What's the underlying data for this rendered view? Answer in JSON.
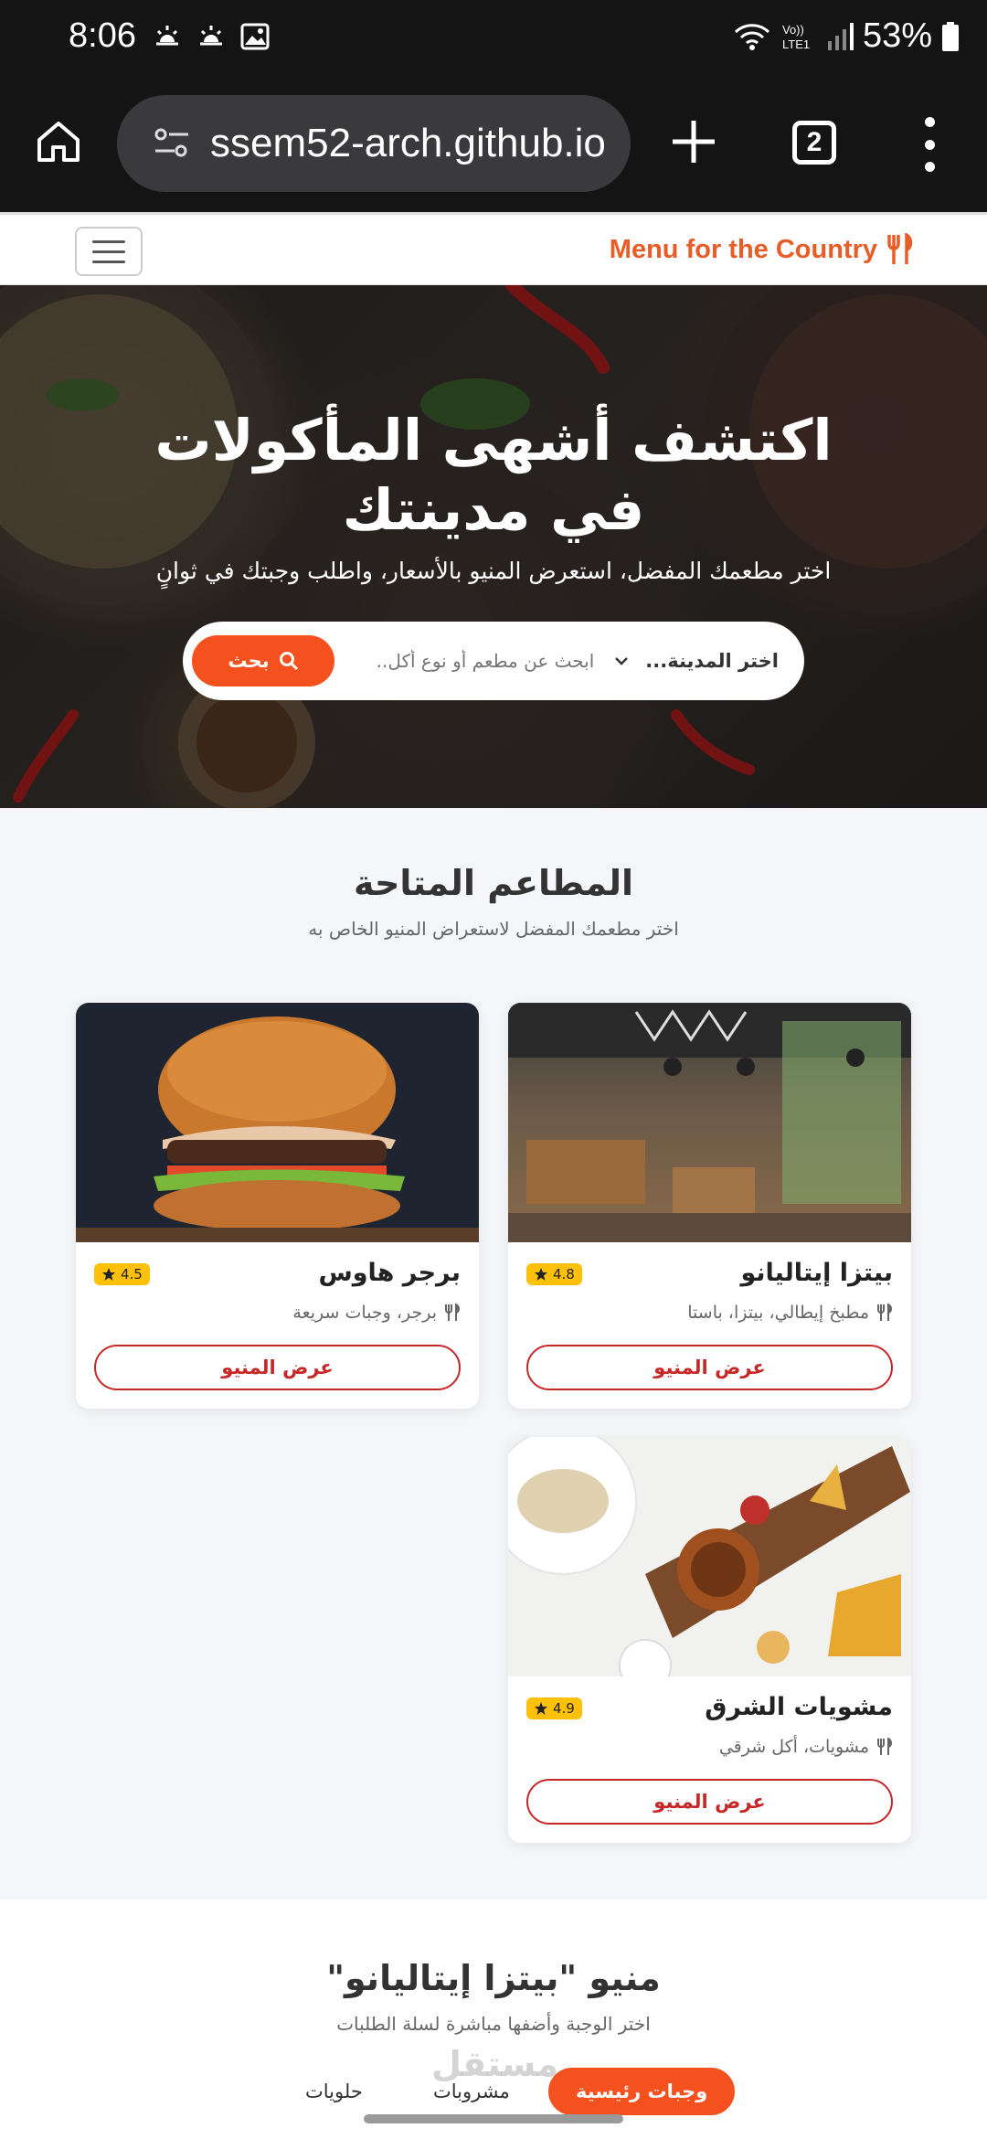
{
  "status_bar": {
    "time": "8:06",
    "battery": "53%"
  },
  "browser": {
    "url": "ssem52-arch.github.io",
    "tab_count": "2"
  },
  "site": {
    "brand": "Menu for the Country"
  },
  "hero": {
    "title": "اكتشف أشهى المأكولات في مدينتك",
    "subtitle": "اختر مطعمك المفضل، استعرض المنيو بالأسعار، واطلب وجبتك في ثوانٍ",
    "city_placeholder": "اختر المدينة...",
    "search_placeholder": "ابحث عن مطعم أو نوع أكل..",
    "search_button": "بحث"
  },
  "restaurants_section": {
    "title": "المطاعم المتاحة",
    "subtitle": "اختر مطعمك المفضل لاستعراض المنيو الخاص به",
    "cards": [
      {
        "name": "بيتزا إيتاليانو",
        "rating": "4.8",
        "cuisine": "مطبخ إيطالي، بيتزا، باستا",
        "button": "عرض المنيو"
      },
      {
        "name": "برجر هاوس",
        "rating": "4.5",
        "cuisine": "برجر، وجبات سريعة",
        "button": "عرض المنيو"
      },
      {
        "name": "مشويات الشرق",
        "rating": "4.9",
        "cuisine": "مشويات، أكل شرقي",
        "button": "عرض المنيو"
      }
    ]
  },
  "menu_section": {
    "title": "منيو \"بيتزا إيتاليانو\"",
    "subtitle": "اختر الوجبة وأضفها مباشرة لسلة الطلبات",
    "tabs": [
      "وجبات رئيسية",
      "مشروبات",
      "حلويات"
    ]
  },
  "watermark": "مستقل",
  "colors": {
    "accent": "#f4511e",
    "brand": "#e85d27",
    "button_outline": "#c62828",
    "rating": "#ffc107"
  }
}
